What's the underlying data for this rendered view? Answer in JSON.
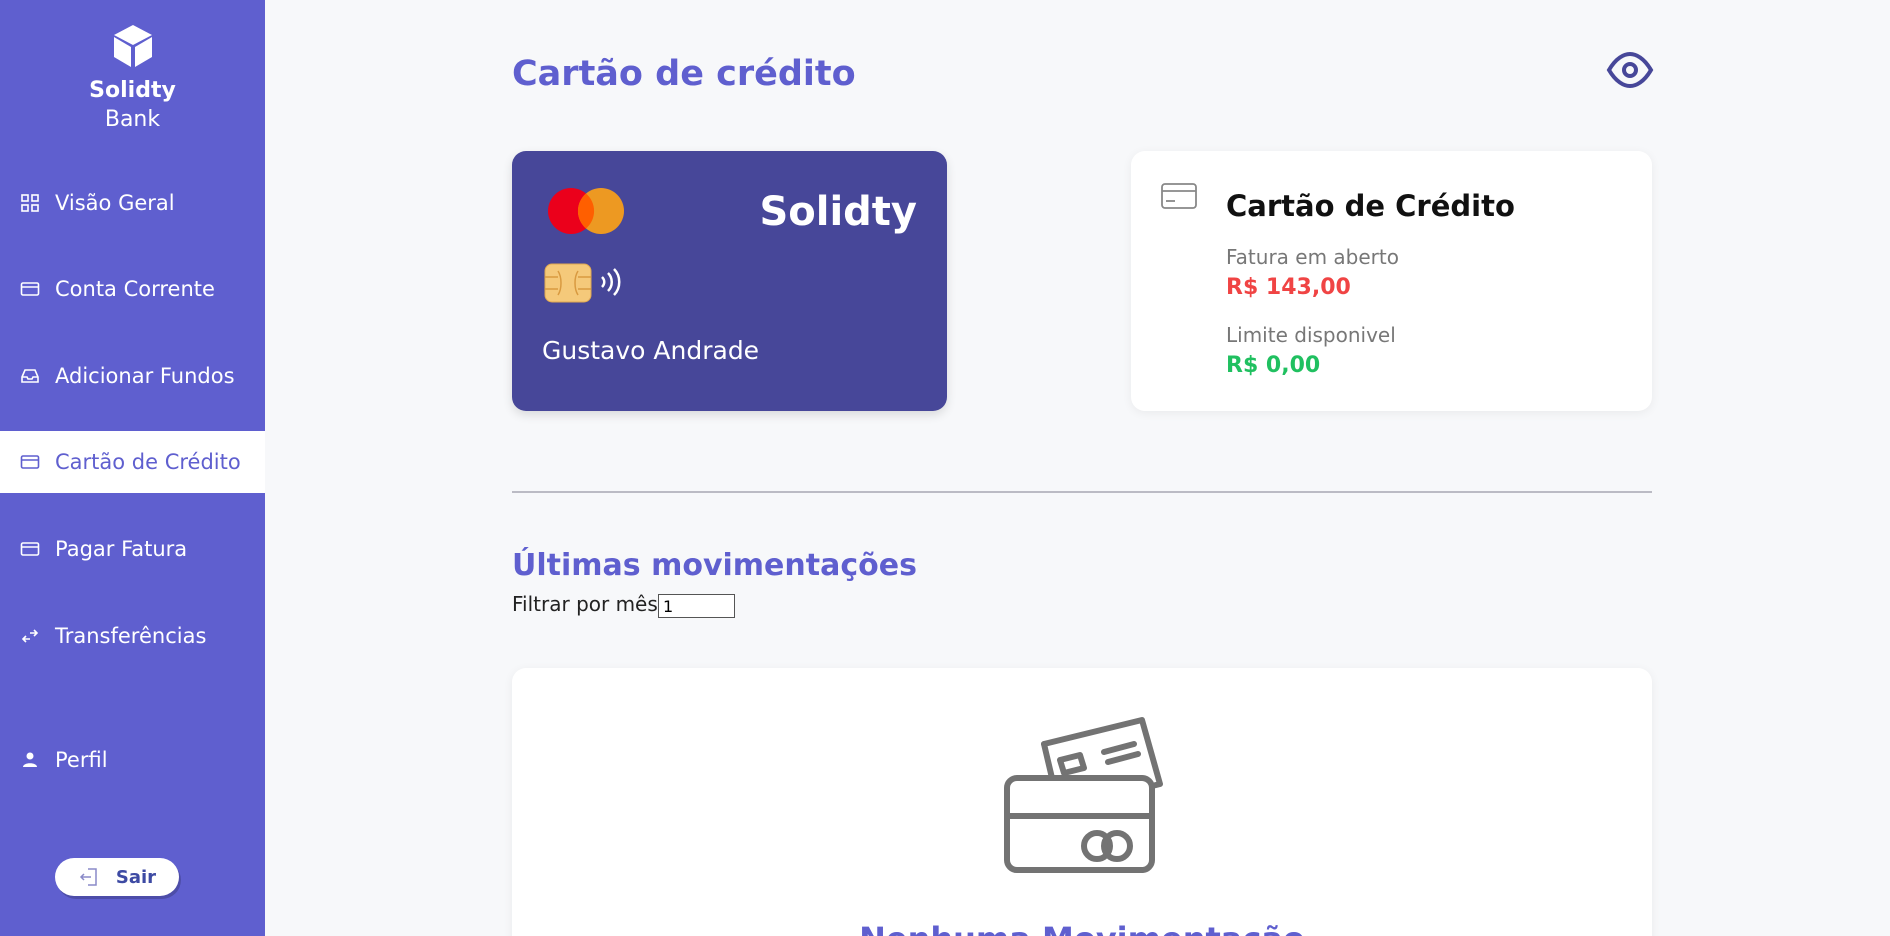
{
  "brand": {
    "name": "Solidty",
    "sub": "Bank"
  },
  "sidebar": {
    "items": [
      {
        "label": "Visão Geral",
        "icon": "grid-icon"
      },
      {
        "label": "Conta Corrente",
        "icon": "card-icon"
      },
      {
        "label": "Adicionar Fundos",
        "icon": "inbox-icon"
      },
      {
        "label": "Cartão de Crédito",
        "icon": "card-icon",
        "active": true
      },
      {
        "label": "Pagar Fatura",
        "icon": "card-icon"
      },
      {
        "label": "Transferências",
        "icon": "transfer-icon"
      },
      {
        "label": "Perfil",
        "icon": "user-icon"
      }
    ],
    "logout_label": "Sair"
  },
  "main": {
    "title": "Cartão de crédito",
    "card": {
      "brand": "Solidty",
      "holder": "Gustavo Andrade"
    },
    "summary": {
      "title": "Cartão de Crédito",
      "open_invoice_label": "Fatura em aberto",
      "open_invoice_value": "R$ 143,00",
      "limit_label": "Limite disponivel",
      "limit_value": "R$ 0,00"
    },
    "movements": {
      "title": "Últimas movimentações",
      "filter_label": "Filtrar por mês:",
      "filter_value": "1",
      "empty_text": "Nenhuma Movimentação"
    }
  },
  "colors": {
    "sidebar": "#5f5fcf",
    "card": "#474799",
    "negative": "#f04444",
    "positive": "#20c060"
  }
}
